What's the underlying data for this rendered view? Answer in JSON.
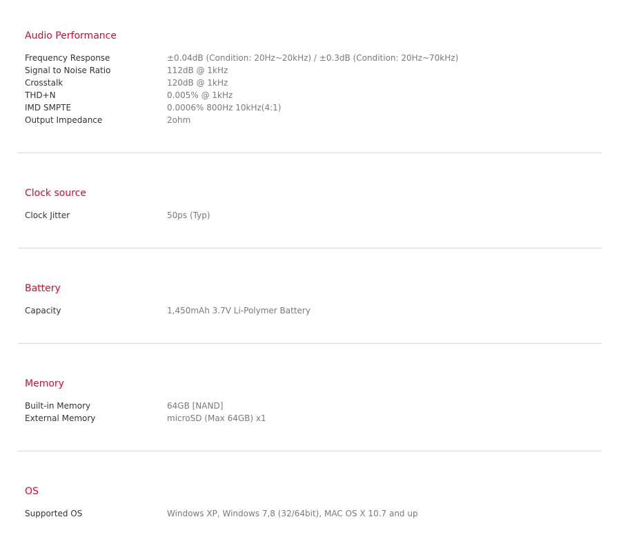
{
  "sections": [
    {
      "title": "Audio Performance",
      "rows": [
        {
          "label": "Frequency Response",
          "value": "±0.04dB (Condition: 20Hz~20kHz) / ±0.3dB (Condition: 20Hz~70kHz)"
        },
        {
          "label": "Signal to Noise Ratio",
          "value": "112dB @ 1kHz"
        },
        {
          "label": "Crosstalk",
          "value": "120dB @ 1kHz"
        },
        {
          "label": "THD+N",
          "value": "0.005% @ 1kHz"
        },
        {
          "label": "IMD SMPTE",
          "value": "0.0006% 800Hz 10kHz(4:1)"
        },
        {
          "label": "Output Impedance",
          "value": "2ohm"
        }
      ]
    },
    {
      "title": "Clock source",
      "rows": [
        {
          "label": "Clock Jitter",
          "value": "50ps (Typ)"
        }
      ]
    },
    {
      "title": "Battery",
      "rows": [
        {
          "label": "Capacity",
          "value": "1,450mAh 3.7V Li-Polymer Battery"
        }
      ]
    },
    {
      "title": "Memory",
      "rows": [
        {
          "label": "Built-in Memory",
          "value": "64GB [NAND]"
        },
        {
          "label": "External Memory",
          "value": "microSD (Max 64GB) x1"
        }
      ]
    },
    {
      "title": "OS",
      "rows": [
        {
          "label": "Supported OS",
          "value": "Windows XP, Windows 7,8 (32/64bit), MAC OS X 10.7 and up"
        }
      ]
    }
  ],
  "colors": {
    "section_title": "#c8102e",
    "label": "#333333",
    "value": "#7a7a7a",
    "divider": "#d6d6d6"
  }
}
